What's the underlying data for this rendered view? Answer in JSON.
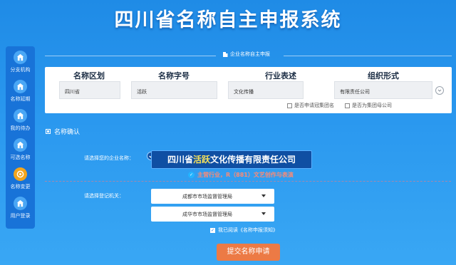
{
  "header": {
    "title": "四川省名称自主申报系统"
  },
  "sidebar": {
    "items": [
      {
        "label": "分支机构",
        "icon": "home-icon",
        "active": false
      },
      {
        "label": "名称延期",
        "icon": "home-icon",
        "active": false
      },
      {
        "label": "我的待办",
        "icon": "home-icon",
        "active": false
      },
      {
        "label": "可选名称",
        "icon": "home-icon",
        "active": false
      },
      {
        "label": "名称变更",
        "icon": "settings-icon",
        "active": true
      },
      {
        "label": "用户登录",
        "icon": "home-icon",
        "active": false
      }
    ]
  },
  "section": {
    "title": "企业名称自主申报"
  },
  "form": {
    "columns": [
      {
        "header": "名称区划",
        "value": "四川省"
      },
      {
        "header": "名称字号",
        "value": "活跃"
      },
      {
        "header": "行业表述",
        "value": "文化传播"
      },
      {
        "header": "组织形式",
        "value": "有限责任公司"
      }
    ],
    "checkboxes": [
      {
        "label": "是否申请冠集团名",
        "checked": false
      },
      {
        "label": "是否为集团母公司",
        "checked": false
      }
    ]
  },
  "confirm": {
    "heading": "名称确认",
    "company_label": "请选择您的企业名称：",
    "company_prefix": "四川省",
    "company_highlight": "活跃",
    "company_suffix": "文化传播有限责任公司",
    "industry_text": "主营行业，R（881）文艺创作与表演",
    "authority_label": "请选择登记机关：",
    "authority_1": "成都市市场监督管理局",
    "authority_2": "成华市市场监督管理局",
    "agree_text": "我已阅读《名称申报须知》",
    "agree_checked": true,
    "submit_label": "提交名称申请"
  }
}
